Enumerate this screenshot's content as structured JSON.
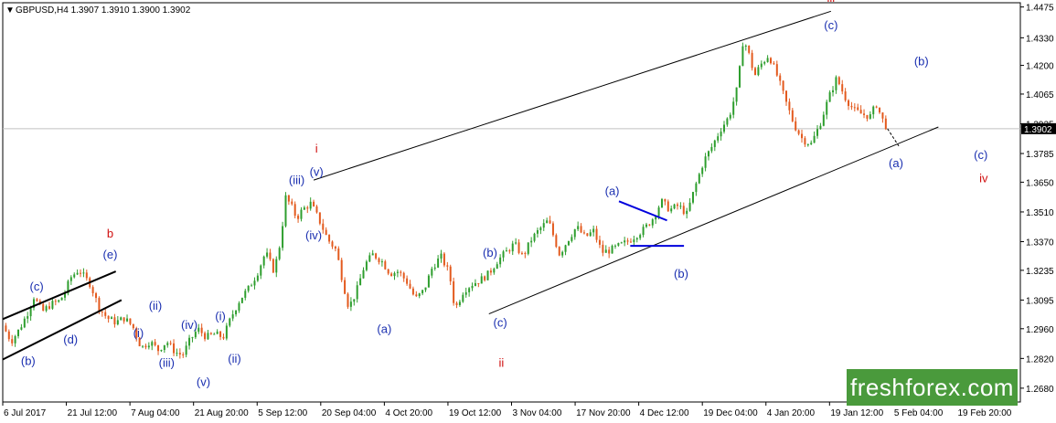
{
  "header": {
    "arrow": "▼",
    "text": "GBPUSD,H4  1.3907 1.3910 1.3900 1.3902"
  },
  "logo": {
    "text": "freshforex.com"
  },
  "chart_data": {
    "type": "candlestick",
    "symbol": "GBPUSD",
    "timeframe": "H4",
    "ohlc_last": {
      "open": 1.3907,
      "high": 1.391,
      "low": 1.39,
      "close": 1.3902
    },
    "current_price": "1.3902",
    "ylim": [
      1.2615,
      1.4495
    ],
    "yticks": [
      "1.4475",
      "1.4330",
      "1.4200",
      "1.4065",
      "1.3925",
      "1.3785",
      "1.3650",
      "1.3510",
      "1.3370",
      "1.3235",
      "1.3095",
      "1.2960",
      "1.2820",
      "1.2680"
    ],
    "xticks": [
      "6 Jul 2017",
      "21 Jul 12:00",
      "7 Aug 04:00",
      "21 Aug 20:00",
      "5 Sep 12:00",
      "20 Sep 04:00",
      "4 Oct 20:00",
      "19 Oct 12:00",
      "3 Nov 04:00",
      "17 Nov 20:00",
      "4 Dec 12:00",
      "19 Dec 04:00",
      "4 Jan 20:00",
      "19 Jan 12:00",
      "5 Feb 04:00",
      "19 Feb 20:00"
    ],
    "colors": {
      "up": "#2e9e2e",
      "down": "#e35a1e",
      "blue_label": "#1a2fb0",
      "red_label": "#d01010",
      "channel": "#000000",
      "triangle": "#0000dd",
      "price_tag": "#000000"
    },
    "path_points": [
      [
        0,
        1.2975
      ],
      [
        0.015,
        1.29
      ],
      [
        0.03,
        1.296
      ],
      [
        0.045,
        1.304
      ],
      [
        0.055,
        1.311
      ],
      [
        0.07,
        1.304
      ],
      [
        0.085,
        1.3075
      ],
      [
        0.1,
        1.309
      ],
      [
        0.11,
        1.313
      ],
      [
        0.12,
        1.32
      ],
      [
        0.135,
        1.324
      ],
      [
        0.145,
        1.32
      ],
      [
        0.155,
        1.317
      ],
      [
        0.17,
        1.306
      ],
      [
        0.185,
        1.301
      ],
      [
        0.2,
        1.299
      ],
      [
        0.215,
        1.301
      ],
      [
        0.23,
        1.297
      ],
      [
        0.245,
        1.287
      ],
      [
        0.26,
        1.29
      ],
      [
        0.275,
        1.286
      ],
      [
        0.29,
        1.29
      ],
      [
        0.305,
        1.285
      ],
      [
        0.318,
        1.2835
      ],
      [
        0.33,
        1.29
      ],
      [
        0.345,
        1.296
      ],
      [
        0.36,
        1.292
      ],
      [
        0.375,
        1.2935
      ],
      [
        0.39,
        1.292
      ],
      [
        0.405,
        1.302
      ],
      [
        0.42,
        1.31
      ],
      [
        0.435,
        1.315
      ],
      [
        0.45,
        1.322
      ],
      [
        0.465,
        1.332
      ],
      [
        0.48,
        1.323
      ],
      [
        0.492,
        1.338
      ],
      [
        0.5,
        1.358
      ],
      [
        0.51,
        1.354
      ],
      [
        0.52,
        1.348
      ],
      [
        0.53,
        1.352
      ],
      [
        0.545,
        1.355
      ],
      [
        0.56,
        1.347
      ],
      [
        0.575,
        1.338
      ],
      [
        0.59,
        1.333
      ],
      [
        0.6,
        1.32
      ],
      [
        0.612,
        1.306
      ],
      [
        0.625,
        1.313
      ],
      [
        0.64,
        1.326
      ],
      [
        0.655,
        1.331
      ],
      [
        0.67,
        1.328
      ],
      [
        0.685,
        1.322
      ],
      [
        0.7,
        1.323
      ],
      [
        0.715,
        1.318
      ],
      [
        0.73,
        1.31
      ],
      [
        0.745,
        1.314
      ],
      [
        0.76,
        1.325
      ],
      [
        0.775,
        1.33
      ],
      [
        0.79,
        1.322
      ],
      [
        0.8,
        1.305
      ],
      [
        0.815,
        1.314
      ],
      [
        0.83,
        1.317
      ],
      [
        0.845,
        1.319
      ],
      [
        0.86,
        1.322
      ],
      [
        0.875,
        1.328
      ],
      [
        0.89,
        1.332
      ],
      [
        0.905,
        1.336
      ],
      [
        0.92,
        1.33
      ],
      [
        0.935,
        1.338
      ],
      [
        0.95,
        1.343
      ],
      [
        0.965,
        1.347
      ],
      [
        0.975,
        1.339
      ],
      [
        0.985,
        1.331
      ],
      [
        1.0,
        1.338
      ],
      [
        1.015,
        1.344
      ],
      [
        1.03,
        1.339
      ],
      [
        1.045,
        1.342
      ],
      [
        1.06,
        1.332
      ],
      [
        1.075,
        1.333
      ],
      [
        1.09,
        1.335
      ],
      [
        1.105,
        1.337
      ],
      [
        1.12,
        1.34
      ],
      [
        1.135,
        1.343
      ],
      [
        1.15,
        1.348
      ],
      [
        1.165,
        1.356
      ],
      [
        1.18,
        1.352
      ],
      [
        1.195,
        1.354
      ],
      [
        1.21,
        1.35
      ],
      [
        1.225,
        1.363
      ],
      [
        1.24,
        1.375
      ],
      [
        1.255,
        1.382
      ],
      [
        1.27,
        1.39
      ],
      [
        1.285,
        1.396
      ],
      [
        1.3,
        1.41
      ],
      [
        1.31,
        1.433
      ],
      [
        1.32,
        1.425
      ],
      [
        1.33,
        1.415
      ],
      [
        1.34,
        1.42
      ],
      [
        1.355,
        1.425
      ],
      [
        1.37,
        1.415
      ],
      [
        1.385,
        1.403
      ],
      [
        1.4,
        1.392
      ],
      [
        1.415,
        1.385
      ],
      [
        1.43,
        1.383
      ],
      [
        1.445,
        1.392
      ],
      [
        1.46,
        1.404
      ],
      [
        1.475,
        1.414
      ],
      [
        1.49,
        1.405
      ],
      [
        1.505,
        1.399
      ],
      [
        1.52,
        1.397
      ],
      [
        1.535,
        1.396
      ],
      [
        1.545,
        1.402
      ],
      [
        1.555,
        1.395
      ],
      [
        1.565,
        1.3902
      ]
    ],
    "channels": [
      {
        "name": "upper-channel-line",
        "points": [
          [
            0.55,
            1.366
          ],
          [
            1.465,
            1.4455
          ]
        ]
      },
      {
        "name": "lower-channel-line",
        "points": [
          [
            0.86,
            1.303
          ],
          [
            1.655,
            1.391
          ]
        ]
      },
      {
        "name": "wedge-upper-line",
        "points": [
          [
            0,
            1.3005
          ],
          [
            0.2,
            1.323
          ]
        ]
      },
      {
        "name": "wedge-lower-line",
        "points": [
          [
            0,
            1.2815
          ],
          [
            0.21,
            1.3095
          ]
        ]
      }
    ],
    "triangle_lines": [
      {
        "name": "triangle-upper-line",
        "points": [
          [
            1.09,
            1.356
          ],
          [
            1.175,
            1.347
          ]
        ]
      },
      {
        "name": "triangle-lower-line",
        "points": [
          [
            1.11,
            1.335
          ],
          [
            1.205,
            1.335
          ]
        ]
      }
    ],
    "wave_labels": [
      {
        "text": "(b)",
        "x": 0.045,
        "y": 1.279,
        "color": "blue"
      },
      {
        "text": "(c)",
        "x": 0.06,
        "y": 1.314,
        "color": "blue"
      },
      {
        "text": "(d)",
        "x": 0.12,
        "y": 1.289,
        "color": "blue"
      },
      {
        "text": "(e)",
        "x": 0.19,
        "y": 1.329,
        "color": "blue"
      },
      {
        "text": "b",
        "x": 0.19,
        "y": 1.339,
        "color": "red"
      },
      {
        "text": "(i)",
        "x": 0.24,
        "y": 1.292,
        "color": "blue"
      },
      {
        "text": "(ii)",
        "x": 0.27,
        "y": 1.305,
        "color": "blue"
      },
      {
        "text": "(iii)",
        "x": 0.29,
        "y": 1.278,
        "color": "blue"
      },
      {
        "text": "(iv)",
        "x": 0.33,
        "y": 1.296,
        "color": "blue"
      },
      {
        "text": "(v)",
        "x": 0.355,
        "y": 1.269,
        "color": "blue"
      },
      {
        "text": "(i)",
        "x": 0.385,
        "y": 1.3,
        "color": "blue"
      },
      {
        "text": "(ii)",
        "x": 0.41,
        "y": 1.28,
        "color": "blue"
      },
      {
        "text": "(iii)",
        "x": 0.52,
        "y": 1.364,
        "color": "blue"
      },
      {
        "text": "(v)",
        "x": 0.555,
        "y": 1.368,
        "color": "blue"
      },
      {
        "text": "i",
        "x": 0.555,
        "y": 1.379,
        "color": "red"
      },
      {
        "text": "(iv)",
        "x": 0.55,
        "y": 1.338,
        "color": "blue"
      },
      {
        "text": "(a)",
        "x": 0.675,
        "y": 1.294,
        "color": "blue"
      },
      {
        "text": "(b)",
        "x": 0.862,
        "y": 1.33,
        "color": "blue"
      },
      {
        "text": "(c)",
        "x": 0.88,
        "y": 1.297,
        "color": "blue"
      },
      {
        "text": "ii",
        "x": 0.882,
        "y": 1.278,
        "color": "red"
      },
      {
        "text": "(a)",
        "x": 1.078,
        "y": 1.359,
        "color": "blue"
      },
      {
        "text": "(b)",
        "x": 1.2,
        "y": 1.32,
        "color": "blue"
      },
      {
        "text": "(c)",
        "x": 1.465,
        "y": 1.437,
        "color": "blue"
      },
      {
        "text": "iii",
        "x": 1.465,
        "y": 1.45,
        "color": "red"
      },
      {
        "text": "(b)",
        "x": 1.625,
        "y": 1.42,
        "color": "blue"
      },
      {
        "text": "(a)",
        "x": 1.58,
        "y": 1.372,
        "color": "blue"
      },
      {
        "text": "(c)",
        "x": 1.73,
        "y": 1.376,
        "color": "blue"
      },
      {
        "text": "iv",
        "x": 1.735,
        "y": 1.365,
        "color": "red"
      }
    ]
  }
}
